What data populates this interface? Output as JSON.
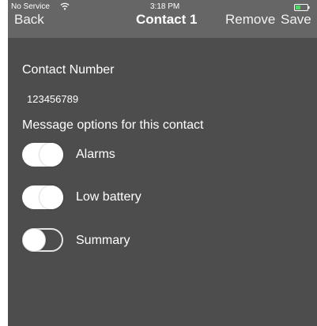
{
  "status_bar": {
    "carrier": "No Service",
    "time": "3:18 PM",
    "wifi_icon": "wifi-icon",
    "battery_icon": "battery-icon",
    "battery_color": "#4cd964"
  },
  "navbar": {
    "back_label": "Back",
    "title": "Contact 1",
    "remove_label": "Remove",
    "save_label": "Save"
  },
  "contact": {
    "number_label": "Contact Number",
    "number_value": "123456789"
  },
  "message_options": {
    "heading": "Message options for this contact",
    "toggles": [
      {
        "label": "Alarms",
        "on": true
      },
      {
        "label": "Low battery",
        "on": true
      },
      {
        "label": "Summary",
        "on": false
      }
    ]
  },
  "colors": {
    "navbar_bg": "#666666",
    "content_bg": "#4d4d4d",
    "toggle_on": "#ffffff"
  }
}
